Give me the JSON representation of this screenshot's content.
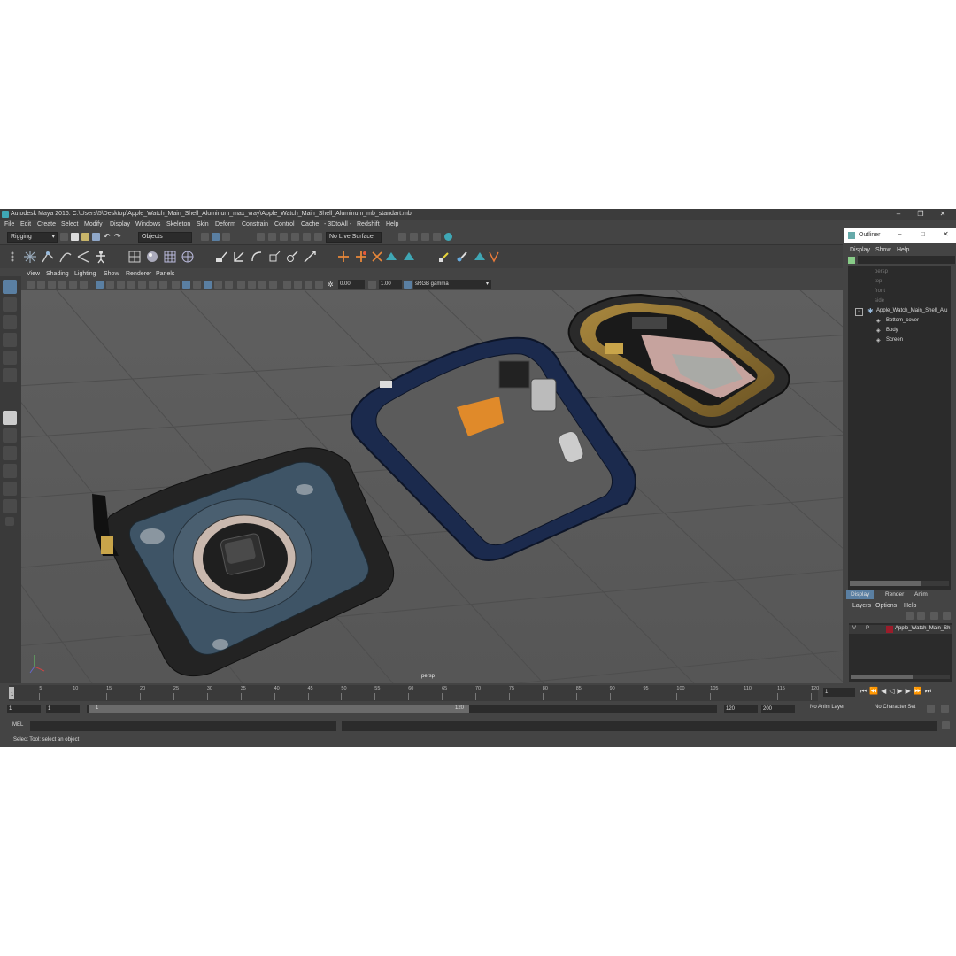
{
  "window": {
    "title": "Autodesk Maya 2016: C:\\Users\\5\\Desktop\\Apple_Watch_Main_Shell_Aluminum_max_vray\\Apple_Watch_Main_Shell_Aluminum_mb_standart.mb",
    "minimize": "–",
    "maximize": "❐",
    "close": "✕"
  },
  "menubar": [
    "File",
    "Edit",
    "Create",
    "Select",
    "Modify",
    "Display",
    "Windows",
    "Skeleton",
    "Skin",
    "Deform",
    "Constrain",
    "Control",
    "Cache",
    "- 3DtoAll -",
    "Redshift",
    "Help"
  ],
  "statusline": {
    "menuset": "Rigging",
    "select_mode": "Objects",
    "live_surface": "No Live Surface"
  },
  "panel": {
    "menus": [
      "View",
      "Shading",
      "Lighting",
      "Show",
      "Renderer",
      "Panels"
    ],
    "exposure": "0.00",
    "gamma": "1.00",
    "colorspace": "sRGB gamma",
    "camera_label": "persp"
  },
  "outliner": {
    "title": "Outliner",
    "menus": [
      "Display",
      "Show",
      "Help"
    ],
    "items": [
      {
        "label": "persp",
        "dim": true
      },
      {
        "label": "top",
        "dim": true
      },
      {
        "label": "front",
        "dim": true
      },
      {
        "label": "side",
        "dim": true
      },
      {
        "label": "Apple_Watch_Main_Shell_Alu",
        "dim": false
      },
      {
        "label": "Bottom_cover",
        "dim": false
      },
      {
        "label": "Body",
        "dim": false
      },
      {
        "label": "Screen",
        "dim": false
      }
    ]
  },
  "layer_editor": {
    "tabs": [
      "Display",
      "Render",
      "Anim"
    ],
    "menus": [
      "Layers",
      "Options",
      "Help"
    ],
    "layer": {
      "v": "V",
      "p": "P",
      "name": "Apple_Watch_Main_Sh"
    }
  },
  "timeline": {
    "ticks": [
      "5",
      "10",
      "15",
      "20",
      "25",
      "30",
      "35",
      "40",
      "45",
      "50",
      "55",
      "60",
      "65",
      "70",
      "75",
      "80",
      "85",
      "90",
      "95",
      "100",
      "105",
      "110",
      "115",
      "120"
    ],
    "current_frame": "1",
    "start_frame": "1",
    "playback_start": "1",
    "range_start": "1",
    "range_end": "120",
    "playback_end": "120",
    "anim_end": "200",
    "anim_layer": "No Anim Layer",
    "character_set": "No Character Set"
  },
  "command": {
    "lang": "MEL"
  },
  "help_line": "Select Tool: select an object",
  "colors": {
    "ui_bg": "#444444",
    "viewport_bg": "#5b5b5b",
    "watch_frame": "#1b2a4d",
    "accent": "#5285a6"
  }
}
